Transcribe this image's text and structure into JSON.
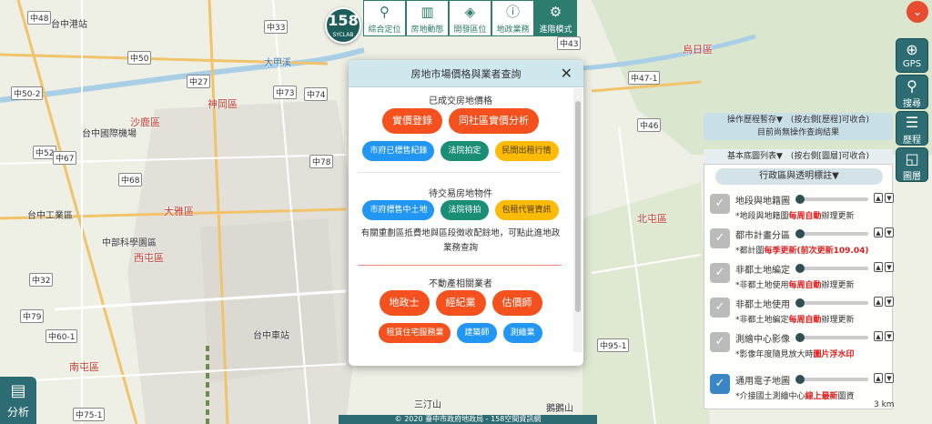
{
  "map": {
    "districts": [
      "神岡區",
      "沙鹿區",
      "大雅區",
      "西屯區",
      "南屯區",
      "北屯區",
      "烏日區"
    ],
    "places": [
      "台中港站",
      "台中國際機場",
      "中部科學園區",
      "台中工業區",
      "台中車站",
      "三汀山",
      "鵝鵝山"
    ],
    "roads": [
      "中48",
      "中50",
      "中52",
      "中43",
      "中33",
      "中27",
      "中32",
      "中73",
      "中78",
      "中79",
      "中46",
      "中47-1",
      "中95-1",
      "中74",
      "中68",
      "中67",
      "中75-1",
      "中60-1",
      "中50-2"
    ],
    "river": "大甲溪"
  },
  "logo": {
    "big": "158",
    "small": "SYCLAB"
  },
  "toolbar": [
    {
      "icon": "map-pin-icon",
      "glyph": "⚲",
      "label": "綜合定位"
    },
    {
      "icon": "building-icon",
      "glyph": "▥",
      "label": "房地動態"
    },
    {
      "icon": "cube-icon",
      "glyph": "◈",
      "label": "開發區位"
    },
    {
      "icon": "info-icon",
      "glyph": "ⓘ",
      "label": "地政業務"
    },
    {
      "icon": "gear-icon",
      "glyph": "⚙",
      "label": "進階模式"
    }
  ],
  "right_tools": [
    {
      "icon": "gps-icon",
      "glyph": "⊕",
      "label": "GPS"
    },
    {
      "icon": "search-icon",
      "glyph": "⚲",
      "label": "搜尋"
    },
    {
      "icon": "history-icon",
      "glyph": "☰",
      "label": "歷程"
    },
    {
      "icon": "layers-icon",
      "glyph": "◱",
      "label": "圖層"
    }
  ],
  "history": {
    "title": "操作歷程暫存▼　(按右側[歷程]可收合)",
    "status": "目前尚無操作查詢結果"
  },
  "basemap": {
    "title": "基本底圖列表▼　(按右側[圖層]可收合)",
    "admin_btn": "行政區與透明標註▼"
  },
  "layers": [
    {
      "name": "地段與地籍圖",
      "note_pre": "*地段與地籍圖",
      "note_red": "每周自動",
      "note_post": "辦理更新",
      "on": false
    },
    {
      "name": "都市計畫分區",
      "note_pre": "*都計圖",
      "note_red": "每季更新(前次更新109.04)",
      "note_post": "",
      "on": false
    },
    {
      "name": "非都土地編定",
      "note_pre": "*非都土地使用",
      "note_red": "每周自動",
      "note_post": "辦理更新",
      "on": false
    },
    {
      "name": "非都土地使用",
      "note_pre": "*非都土地編定",
      "note_red": "每周自動",
      "note_post": "辦理更新",
      "on": false
    },
    {
      "name": "測繪中心影像",
      "note_pre": "*影像年度隨見放大時",
      "note_red": "圖片浮水印",
      "note_post": "",
      "on": false
    },
    {
      "name": "通用電子地圖",
      "note_pre": "*介接國土測繪中心",
      "note_red": "線上最新",
      "note_post": "圖資",
      "on": true
    }
  ],
  "analysis": {
    "icon": "analysis-icon",
    "label": "分析"
  },
  "copyright": "© 2020 臺中市政府地政局 - 158空間資訊網",
  "scale": "3 km",
  "modal": {
    "title": "房地市場價格與業者查詢",
    "close": "✕",
    "sec1": {
      "title": "已成交房地價格",
      "big": [
        "實價登錄",
        "同社區實價分析"
      ],
      "small": [
        "市府已標售紀錄",
        "法院拍定",
        "民間出租行情"
      ]
    },
    "sec2": {
      "title": "待交易房地物件",
      "small": [
        "市府標售中土地",
        "法院待拍",
        "包租代管資訊"
      ],
      "note": "有關重劃區抵費地與區段徵收配餘地，可點此進地政業務查詢"
    },
    "sec3": {
      "title": "不動產相關業者",
      "big": [
        "地政士",
        "經紀業",
        "估價師"
      ],
      "small": [
        "租賃住宅服務業",
        "建築師",
        "測繪業"
      ]
    }
  },
  "colors": {
    "accent": "#2d6c73",
    "orange": "#f4511e",
    "blue": "#2196f3",
    "green": "#1a8f76",
    "yellow": "#fcbb06"
  }
}
